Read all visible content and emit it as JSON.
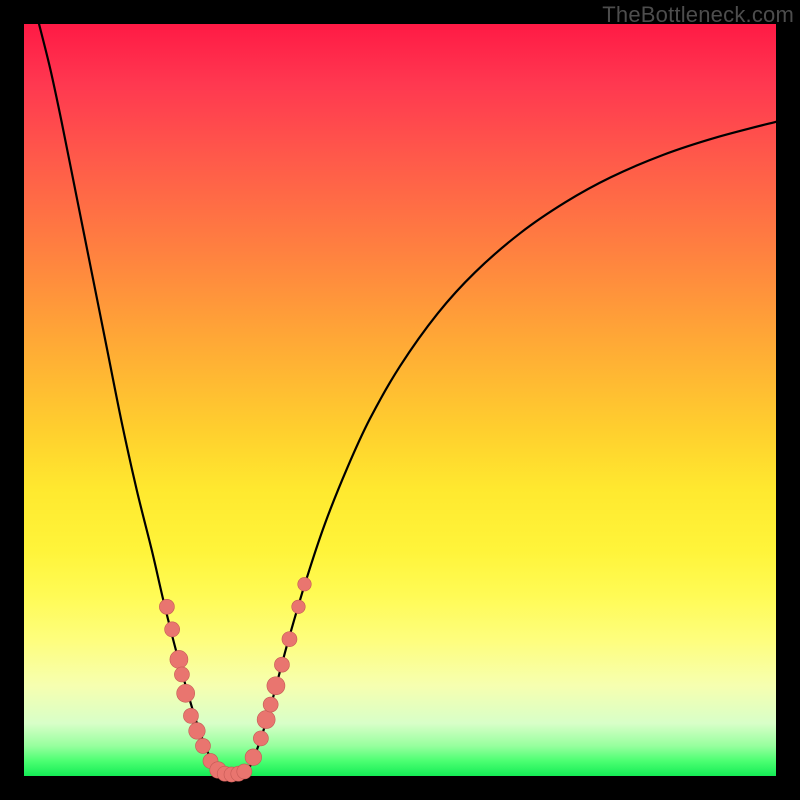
{
  "watermark": {
    "text": "TheBottleneck.com"
  },
  "colors": {
    "curve": "#000000",
    "dot_fill": "#e9756f",
    "dot_stroke": "#c55a55",
    "bg_black": "#000000"
  },
  "chart_data": {
    "type": "line",
    "title": "",
    "xlabel": "",
    "ylabel": "",
    "xlim": [
      0,
      100
    ],
    "ylim": [
      0,
      100
    ],
    "grid": false,
    "curve_points": [
      {
        "x": 2.0,
        "y": 100.0
      },
      {
        "x": 3.5,
        "y": 94.0
      },
      {
        "x": 5.0,
        "y": 87.0
      },
      {
        "x": 7.0,
        "y": 77.0
      },
      {
        "x": 9.0,
        "y": 67.0
      },
      {
        "x": 11.0,
        "y": 57.0
      },
      {
        "x": 13.0,
        "y": 47.0
      },
      {
        "x": 15.0,
        "y": 38.0
      },
      {
        "x": 17.0,
        "y": 30.0
      },
      {
        "x": 18.5,
        "y": 23.5
      },
      {
        "x": 20.0,
        "y": 17.5
      },
      {
        "x": 21.5,
        "y": 12.0
      },
      {
        "x": 23.0,
        "y": 7.0
      },
      {
        "x": 24.5,
        "y": 3.0
      },
      {
        "x": 25.8,
        "y": 0.8
      },
      {
        "x": 27.0,
        "y": 0.2
      },
      {
        "x": 28.5,
        "y": 0.2
      },
      {
        "x": 30.0,
        "y": 1.2
      },
      {
        "x": 31.5,
        "y": 5.0
      },
      {
        "x": 33.0,
        "y": 10.0
      },
      {
        "x": 35.0,
        "y": 17.5
      },
      {
        "x": 37.5,
        "y": 26.0
      },
      {
        "x": 40.0,
        "y": 33.5
      },
      {
        "x": 43.0,
        "y": 41.0
      },
      {
        "x": 46.0,
        "y": 47.5
      },
      {
        "x": 50.0,
        "y": 54.5
      },
      {
        "x": 55.0,
        "y": 61.5
      },
      {
        "x": 60.0,
        "y": 67.0
      },
      {
        "x": 66.0,
        "y": 72.2
      },
      {
        "x": 72.0,
        "y": 76.3
      },
      {
        "x": 78.0,
        "y": 79.6
      },
      {
        "x": 85.0,
        "y": 82.6
      },
      {
        "x": 92.0,
        "y": 84.9
      },
      {
        "x": 100.0,
        "y": 87.0
      }
    ],
    "dots": [
      {
        "x": 19.0,
        "y": 22.5,
        "r": 1.0
      },
      {
        "x": 19.7,
        "y": 19.5,
        "r": 1.0
      },
      {
        "x": 20.6,
        "y": 15.5,
        "r": 1.2
      },
      {
        "x": 21.0,
        "y": 13.5,
        "r": 1.0
      },
      {
        "x": 21.5,
        "y": 11.0,
        "r": 1.2
      },
      {
        "x": 22.2,
        "y": 8.0,
        "r": 1.0
      },
      {
        "x": 23.0,
        "y": 6.0,
        "r": 1.1
      },
      {
        "x": 23.8,
        "y": 4.0,
        "r": 1.0
      },
      {
        "x": 24.8,
        "y": 2.0,
        "r": 1.0
      },
      {
        "x": 25.8,
        "y": 0.8,
        "r": 1.1
      },
      {
        "x": 26.7,
        "y": 0.3,
        "r": 1.0
      },
      {
        "x": 27.6,
        "y": 0.2,
        "r": 1.0
      },
      {
        "x": 28.5,
        "y": 0.3,
        "r": 1.0
      },
      {
        "x": 29.3,
        "y": 0.6,
        "r": 1.0
      },
      {
        "x": 30.5,
        "y": 2.5,
        "r": 1.1
      },
      {
        "x": 31.5,
        "y": 5.0,
        "r": 1.0
      },
      {
        "x": 32.2,
        "y": 7.5,
        "r": 1.2
      },
      {
        "x": 32.8,
        "y": 9.5,
        "r": 1.0
      },
      {
        "x": 33.5,
        "y": 12.0,
        "r": 1.2
      },
      {
        "x": 34.3,
        "y": 14.8,
        "r": 1.0
      },
      {
        "x": 35.3,
        "y": 18.2,
        "r": 1.0
      },
      {
        "x": 36.5,
        "y": 22.5,
        "r": 0.9
      },
      {
        "x": 37.3,
        "y": 25.5,
        "r": 0.9
      }
    ]
  }
}
